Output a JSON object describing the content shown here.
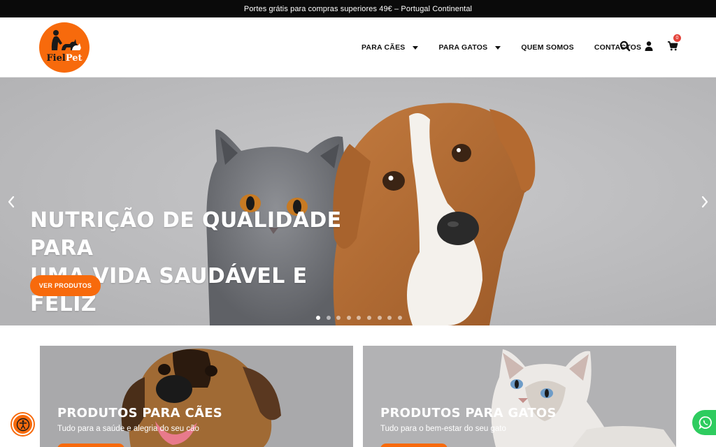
{
  "announcement": "Portes grátis para compras superiores 49€ – Portugal Continental",
  "logo": {
    "text_main": "Fiel",
    "text_accent": "Pet"
  },
  "nav": {
    "items": [
      {
        "label": "PARA CÃES",
        "has_dropdown": true
      },
      {
        "label": "PARA GATOS",
        "has_dropdown": true
      },
      {
        "label": "QUEM SOMOS",
        "has_dropdown": false
      },
      {
        "label": "CONTACTOS",
        "has_dropdown": false
      }
    ],
    "icons": [
      "search-icon",
      "user-icon",
      "cart-icon"
    ],
    "cart_count": "0"
  },
  "hero": {
    "title_line1": "NUTRIÇÃO DE QUALIDADE PARA",
    "title_line2": "UMA VIDA SAUDÁVEL E FELIZ",
    "button": "VER PRODUTOS",
    "slide_count": 9,
    "active_slide": 1
  },
  "cards": [
    {
      "title": "PRODUTOS PARA CÃES",
      "subtitle": "Tudo para a saúde e alegria do seu cão"
    },
    {
      "title": "PRODUTOS PARA GATOS",
      "subtitle": "Tudo para o bem-estar do seu gato"
    }
  ],
  "colors": {
    "brand_orange": "#f76a0c",
    "topbar": "#0a0a0a",
    "whatsapp": "#2ecc5f",
    "badge": "#e4443b"
  }
}
